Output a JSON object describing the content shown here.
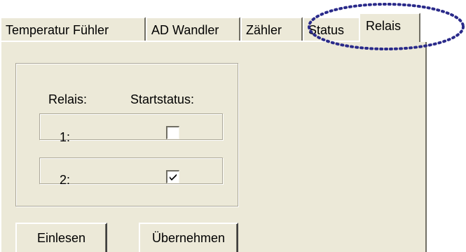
{
  "tabs": [
    {
      "label": "Temperatur Fühler",
      "active": false
    },
    {
      "label": "AD Wandler",
      "active": false
    },
    {
      "label": "Zähler",
      "active": false
    },
    {
      "label": "Status",
      "active": false
    },
    {
      "label": "Relais",
      "active": true
    }
  ],
  "group": {
    "col_relais": "Relais:",
    "col_startstatus": "Startstatus:",
    "rows": [
      {
        "label": "1:",
        "checked": false
      },
      {
        "label": "2:",
        "checked": true
      }
    ]
  },
  "buttons": {
    "read": "Einlesen",
    "apply": "Übernehmen"
  },
  "colors": {
    "dialog_bg": "#ece9d8",
    "annotation": "#2a2a8a"
  }
}
